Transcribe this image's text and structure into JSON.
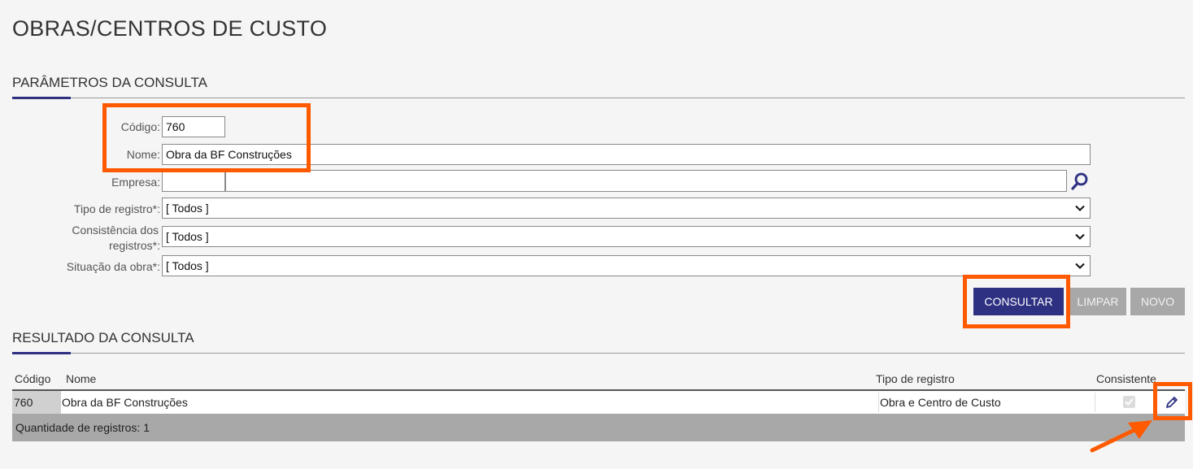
{
  "page": {
    "title": "OBRAS/CENTROS DE CUSTO"
  },
  "params": {
    "section_title": "PARÂMETROS DA CONSULTA",
    "codigo": {
      "label": "Código:",
      "value": "760"
    },
    "nome": {
      "label": "Nome:",
      "value": "Obra da BF Construções"
    },
    "empresa": {
      "label": "Empresa:",
      "code_value": "",
      "name_value": ""
    },
    "tipo_registro": {
      "label": "Tipo de registro*:",
      "value": "[ Todos ]"
    },
    "consistencia": {
      "label_line1": "Consistência dos",
      "label_line2": "registros*:",
      "value": "[ Todos ]"
    },
    "situacao": {
      "label": "Situação da obra*:",
      "value": "[ Todos ]"
    }
  },
  "buttons": {
    "consultar": "CONSULTAR",
    "limpar": "LIMPAR",
    "novo": "NOVO"
  },
  "results": {
    "section_title": "RESULTADO DA CONSULTA",
    "columns": {
      "codigo": "Código",
      "nome": "Nome",
      "tipo": "Tipo de registro",
      "consistente": "Consistente"
    },
    "rows": [
      {
        "codigo": "760",
        "nome": "Obra da BF Construções",
        "tipo": "Obra e Centro de Custo",
        "consistente": true
      }
    ],
    "footer": "Quantidade de registros: 1"
  },
  "colors": {
    "accent": "#2e3082",
    "highlight": "#ff5a00",
    "disabled": "#a8a8a8"
  },
  "icons": {
    "search": "search-icon",
    "chevron": "chevron-down-icon",
    "edit": "pencil-icon",
    "arrow": "arrow-annotation"
  }
}
